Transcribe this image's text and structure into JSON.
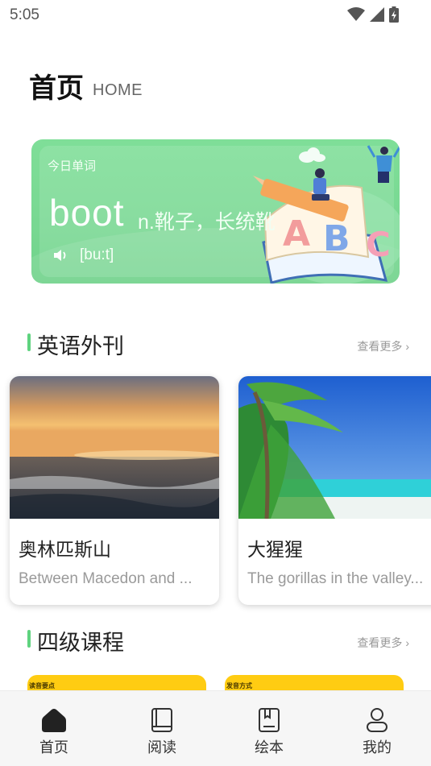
{
  "status_bar": {
    "time": "5:05"
  },
  "header": {
    "title": "首页",
    "subtitle": "HOME"
  },
  "word_card": {
    "label": "今日单词",
    "word": "boot",
    "meaning": "n.靴子，长统靴",
    "phonetic": "[bu:t]",
    "illustration_letters": [
      "A",
      "B",
      "C"
    ]
  },
  "sections": {
    "magazine": {
      "title": "英语外刊",
      "more": "查看更多"
    },
    "course": {
      "title": "四级课程",
      "more": "查看更多"
    }
  },
  "magazines": [
    {
      "title": "奥林匹斯山",
      "desc": "Between Macedon and ..."
    },
    {
      "title": "大猩猩",
      "desc": "The gorillas in the valley..."
    }
  ],
  "courses": [
    {
      "label": "读音要点"
    },
    {
      "label": "发音方式"
    }
  ],
  "nav": [
    {
      "label": "首页",
      "icon": "home-icon",
      "active": true
    },
    {
      "label": "阅读",
      "icon": "book-icon",
      "active": false
    },
    {
      "label": "绘本",
      "icon": "picture-book-icon",
      "active": false
    },
    {
      "label": "我的",
      "icon": "user-icon",
      "active": false
    }
  ],
  "colors": {
    "accent": "#5fd37f",
    "card": "#7fde98",
    "course": "#ffcc12"
  }
}
